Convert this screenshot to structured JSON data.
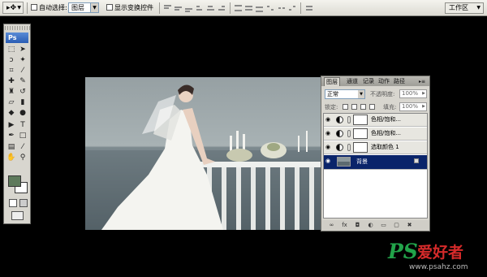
{
  "options_bar": {
    "auto_select_label": "自动选择:",
    "auto_select_value": "图层",
    "show_transform_label": "显示变换控件",
    "workspace_label": "工作区"
  },
  "toolbox": {
    "logo": "Ps",
    "foreground_color": "#5e7a5c",
    "background_color": "#ffffff"
  },
  "layers_panel": {
    "tabs": [
      "图层",
      "通道",
      "记录",
      "动作",
      "路径"
    ],
    "blend_mode": "正常",
    "opacity_label": "不透明度:",
    "opacity_value": "100%",
    "lock_label": "锁定:",
    "fill_label": "填充:",
    "fill_value": "100%",
    "layers": [
      {
        "name": "色相/饱和...",
        "type": "adjustment"
      },
      {
        "name": "色相/饱和...",
        "type": "adjustment"
      },
      {
        "name": "选取颜色 1",
        "type": "adjustment"
      },
      {
        "name": "背景",
        "type": "background",
        "active": true
      }
    ]
  },
  "watermark": {
    "brand": "PS",
    "site_name": "爱好者",
    "url": "www.psahz.com"
  }
}
